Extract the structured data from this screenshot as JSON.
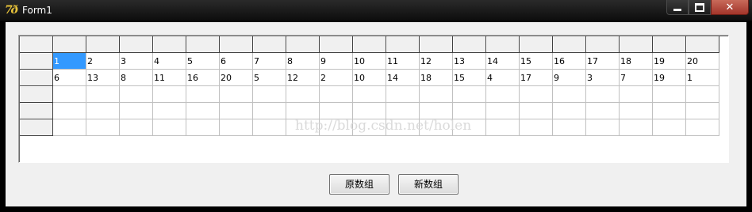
{
  "window": {
    "title": "Form1",
    "icon": "delphi-app-icon",
    "icon_glyph": "7ð"
  },
  "grid": {
    "data_rows": [
      [
        "1",
        "2",
        "3",
        "4",
        "5",
        "6",
        "7",
        "8",
        "9",
        "10",
        "11",
        "12",
        "13",
        "14",
        "15",
        "16",
        "17",
        "18",
        "19",
        "20"
      ],
      [
        "6",
        "13",
        "8",
        "11",
        "16",
        "20",
        "5",
        "12",
        "2",
        "10",
        "14",
        "18",
        "15",
        "4",
        "17",
        "9",
        "3",
        "7",
        "19",
        "1"
      ],
      [
        "",
        "",
        "",
        "",
        "",
        "",
        "",
        "",
        "",
        "",
        "",
        "",
        "",
        "",
        "",
        "",
        "",
        "",
        "",
        ""
      ],
      [
        "",
        "",
        "",
        "",
        "",
        "",
        "",
        "",
        "",
        "",
        "",
        "",
        "",
        "",
        "",
        "",
        "",
        "",
        "",
        ""
      ],
      [
        "",
        "",
        "",
        "",
        "",
        "",
        "",
        "",
        "",
        "",
        "",
        "",
        "",
        "",
        "",
        "",
        "",
        "",
        "",
        ""
      ]
    ],
    "selected_cell": {
      "row": 0,
      "col": 0
    }
  },
  "watermark": "http://blog.csdn.net/holen",
  "buttons": {
    "original_label": "原数组",
    "new_label": "新数组"
  }
}
